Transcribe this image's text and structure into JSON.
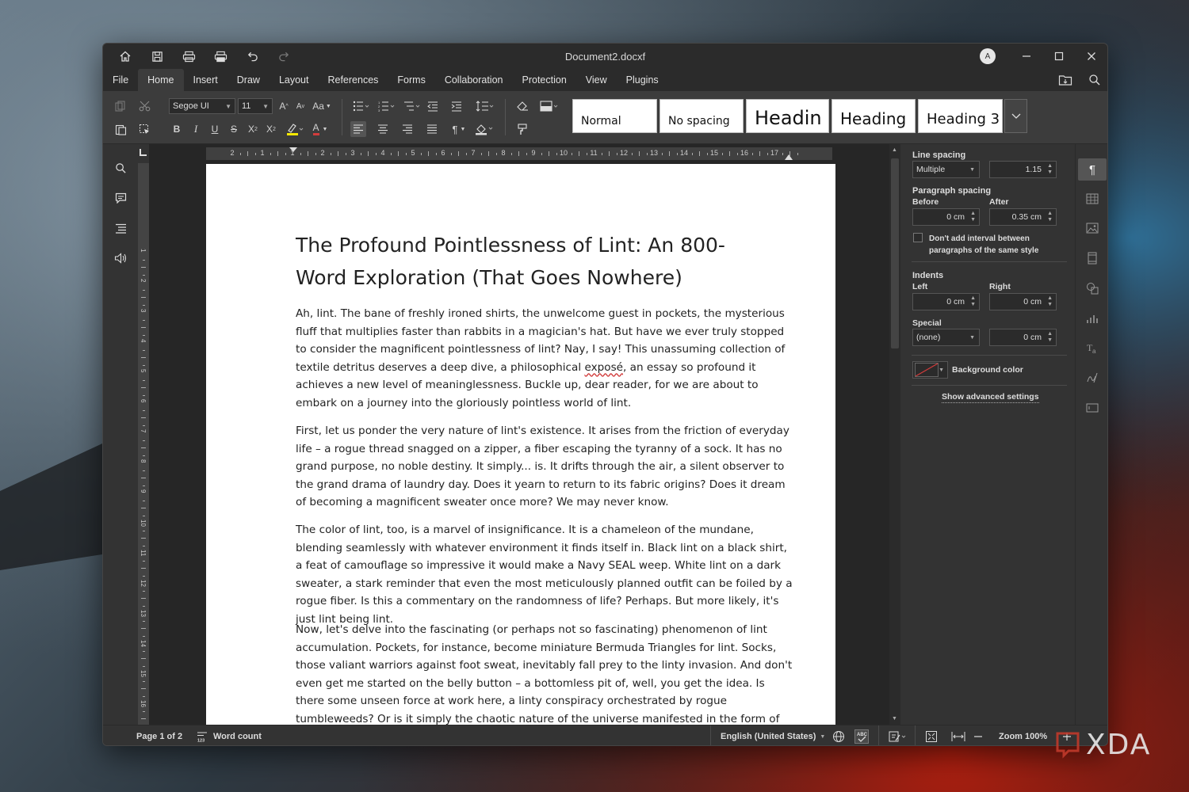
{
  "window": {
    "title": "Document2.docxf",
    "avatar_letter": "A"
  },
  "quick_access": [
    "home-icon",
    "save-icon",
    "print-icon",
    "quick-print-icon",
    "undo-icon",
    "redo-icon"
  ],
  "menu": {
    "items": [
      "File",
      "Home",
      "Insert",
      "Draw",
      "Layout",
      "References",
      "Forms",
      "Collaboration",
      "Protection",
      "View",
      "Plugins"
    ],
    "active": "Home"
  },
  "toolbar": {
    "font_name": "Segoe UI",
    "font_size": "11",
    "increase_font": "A",
    "decrease_font": "A",
    "change_case": "Aa",
    "bold": "B",
    "italic": "I",
    "underline": "U",
    "strike": "S",
    "superscript": "X",
    "subscript": "X",
    "font_color": "A",
    "styles": [
      "Normal",
      "No spacing",
      "Headin",
      "Heading",
      "Heading 3"
    ]
  },
  "document": {
    "title": "The Profound Pointlessness of Lint: An 800-Word Exploration (That Goes Nowhere)",
    "paragraphs": [
      "Ah, lint. The bane of freshly ironed shirts, the unwelcome guest in pockets, the mysterious fluff that multiplies faster than rabbits in a magician's hat. But have we ever truly stopped to consider the magnificent pointlessness of lint? Nay, I say! This unassuming collection of textile detritus deserves a deep dive, a philosophical exposé, an essay so profound it achieves a new level of meaninglessness. Buckle up, dear reader, for we are about to embark on a journey into the gloriously pointless world of lint.",
      "First, let us ponder the very nature of lint's existence. It arises from the friction of everyday life – a rogue thread snagged on a zipper, a fiber escaping the tyranny of a sock. It has no grand purpose, no noble destiny. It simply... is. It drifts through the air, a silent observer to the grand drama of laundry day. Does it yearn to return to its fabric origins? Does it dream of becoming a magnificent sweater once more? We may never know.",
      "The color of lint, too, is a marvel of insignificance. It is a chameleon of the mundane, blending seamlessly with whatever environment it finds itself in. Black lint on a black shirt, a feat of camouflage so impressive it would make a Navy SEAL weep. White lint on a dark sweater, a stark reminder that even the most meticulously planned outfit can be foiled by a rogue fiber. Is this a commentary on the randomness of life? Perhaps. But more likely, it's just lint being lint.",
      "Now, let's delve into the fascinating (or perhaps not so fascinating) phenomenon of lint accumulation. Pockets, for instance, become miniature Bermuda Triangles for lint. Socks, those valiant warriors against foot sweat, inevitably fall prey to the linty invasion. And don't even get me started on the belly button – a bottomless pit of, well, you get the idea. Is there some unseen force at work here, a linty conspiracy orchestrated by rogue tumbleweeds? Or is it simply the chaotic nature of the universe manifested in the form of pocket fluff?"
    ]
  },
  "ruler": {
    "h_numbers": [
      "2",
      "1",
      "1",
      "2",
      "3",
      "4",
      "5",
      "6",
      "7",
      "8",
      "9",
      "10",
      "11",
      "12",
      "13",
      "14",
      "15",
      "16",
      "17"
    ],
    "v_numbers": [
      "1",
      "2",
      "3",
      "4",
      "5",
      "6",
      "7",
      "8",
      "9",
      "10",
      "11",
      "12",
      "13",
      "14",
      "15",
      "16",
      "17"
    ]
  },
  "paragraph_panel": {
    "line_spacing_label": "Line spacing",
    "line_spacing_mode": "Multiple",
    "line_spacing_value": "1.15",
    "paragraph_spacing_label": "Paragraph spacing",
    "before_label": "Before",
    "before_value": "0 cm",
    "after_label": "After",
    "after_value": "0.35 cm",
    "no_interval_line1": "Don't add interval between",
    "no_interval_line2": "paragraphs of the same style",
    "indents_label": "Indents",
    "left_label": "Left",
    "left_value": "0 cm",
    "right_label": "Right",
    "right_value": "0 cm",
    "special_label": "Special",
    "special_value": "(none)",
    "special_amount": "0 cm",
    "background_color_label": "Background color",
    "advanced_link": "Show advanced settings"
  },
  "statusbar": {
    "page": "Page 1 of 2",
    "word_count": "Word count",
    "language": "English (United States)",
    "zoom": "Zoom 100%"
  },
  "watermark": "XDA",
  "colors": {
    "window_bg": "#2b2b2b",
    "toolbar_bg": "#3c3c3c",
    "highlight_yellow": "#f5e800",
    "font_color_red": "#d23c3c"
  }
}
